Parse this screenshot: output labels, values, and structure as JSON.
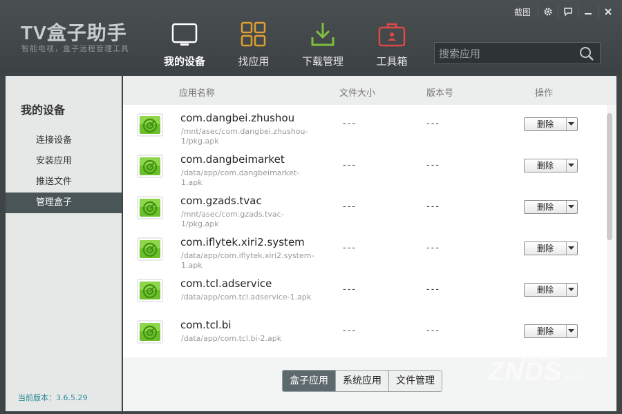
{
  "app": {
    "logo": "TV盒子助手",
    "slogan": "智能电视，盒子远程管理工具"
  },
  "window_controls": {
    "screenshot_label": "截图"
  },
  "nav": [
    {
      "label": "我的设备",
      "icon": "tv-icon",
      "active": true
    },
    {
      "label": "找应用",
      "icon": "grid-icon",
      "active": false
    },
    {
      "label": "下载管理",
      "icon": "download-icon",
      "active": false
    },
    {
      "label": "工具箱",
      "icon": "toolbox-icon",
      "active": false
    }
  ],
  "search": {
    "placeholder": "搜索应用"
  },
  "sidebar": {
    "title": "我的设备",
    "items": [
      {
        "label": "连接设备",
        "active": false
      },
      {
        "label": "安装应用",
        "active": false
      },
      {
        "label": "推送文件",
        "active": false
      },
      {
        "label": "管理盒子",
        "active": true
      }
    ],
    "version": "当前版本：3.6.5.29"
  },
  "table": {
    "headers": {
      "name": "应用名称",
      "size": "文件大小",
      "version": "版本号",
      "action": "操作"
    },
    "rows": [
      {
        "name": "com.dangbei.zhushou",
        "path": "/mnt/asec/com.dangbei.zhushou-1/pkg.apk",
        "size": "---",
        "version": "---",
        "action": "删除"
      },
      {
        "name": "com.dangbeimarket",
        "path": "/data/app/com.dangbeimarket-1.apk",
        "size": "---",
        "version": "---",
        "action": "删除"
      },
      {
        "name": "com.gzads.tvac",
        "path": "/mnt/asec/com.gzads.tvac-1/pkg.apk",
        "size": "---",
        "version": "---",
        "action": "删除"
      },
      {
        "name": "com.iflytek.xiri2.system",
        "path": "/data/app/com.iflytek.xiri2.system-1.apk",
        "size": "---",
        "version": "---",
        "action": "删除"
      },
      {
        "name": "com.tcl.adservice",
        "path": "/data/app/com.tcl.adservice-1.apk",
        "size": "---",
        "version": "---",
        "action": "删除"
      },
      {
        "name": "com.tcl.bi",
        "path": "/data/app/com.tcl.bi-2.apk",
        "size": "---",
        "version": "---",
        "action": "删除"
      }
    ]
  },
  "tabs": [
    {
      "label": "盒子应用",
      "active": true
    },
    {
      "label": "系统应用",
      "active": false
    },
    {
      "label": "文件管理",
      "active": false
    }
  ],
  "watermark": {
    "text": "ZNDS",
    "suffix": ".com",
    "cn": "智能电视网"
  }
}
